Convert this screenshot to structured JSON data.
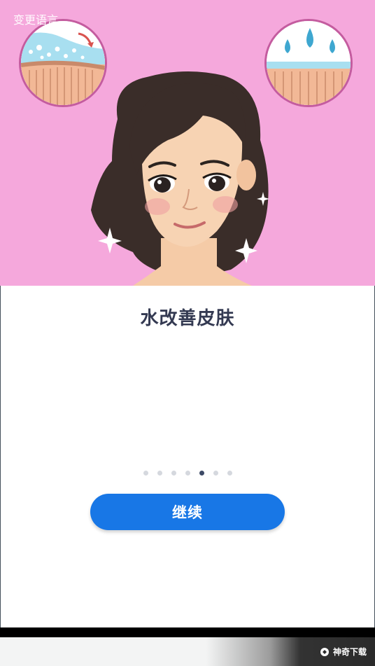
{
  "header": {
    "language_link": "变更语言"
  },
  "onboarding": {
    "title": "水改善皮肤",
    "page_indicator": {
      "total": 7,
      "active_index": 4
    },
    "continue_label": "继续"
  },
  "watermark": {
    "text": "神奇下载"
  },
  "colors": {
    "hero_background": "#f5a8dc",
    "accent": "#1877e6",
    "title_text": "#343a52",
    "dot_inactive": "#d5d8de",
    "dot_active": "#3d4a66"
  }
}
